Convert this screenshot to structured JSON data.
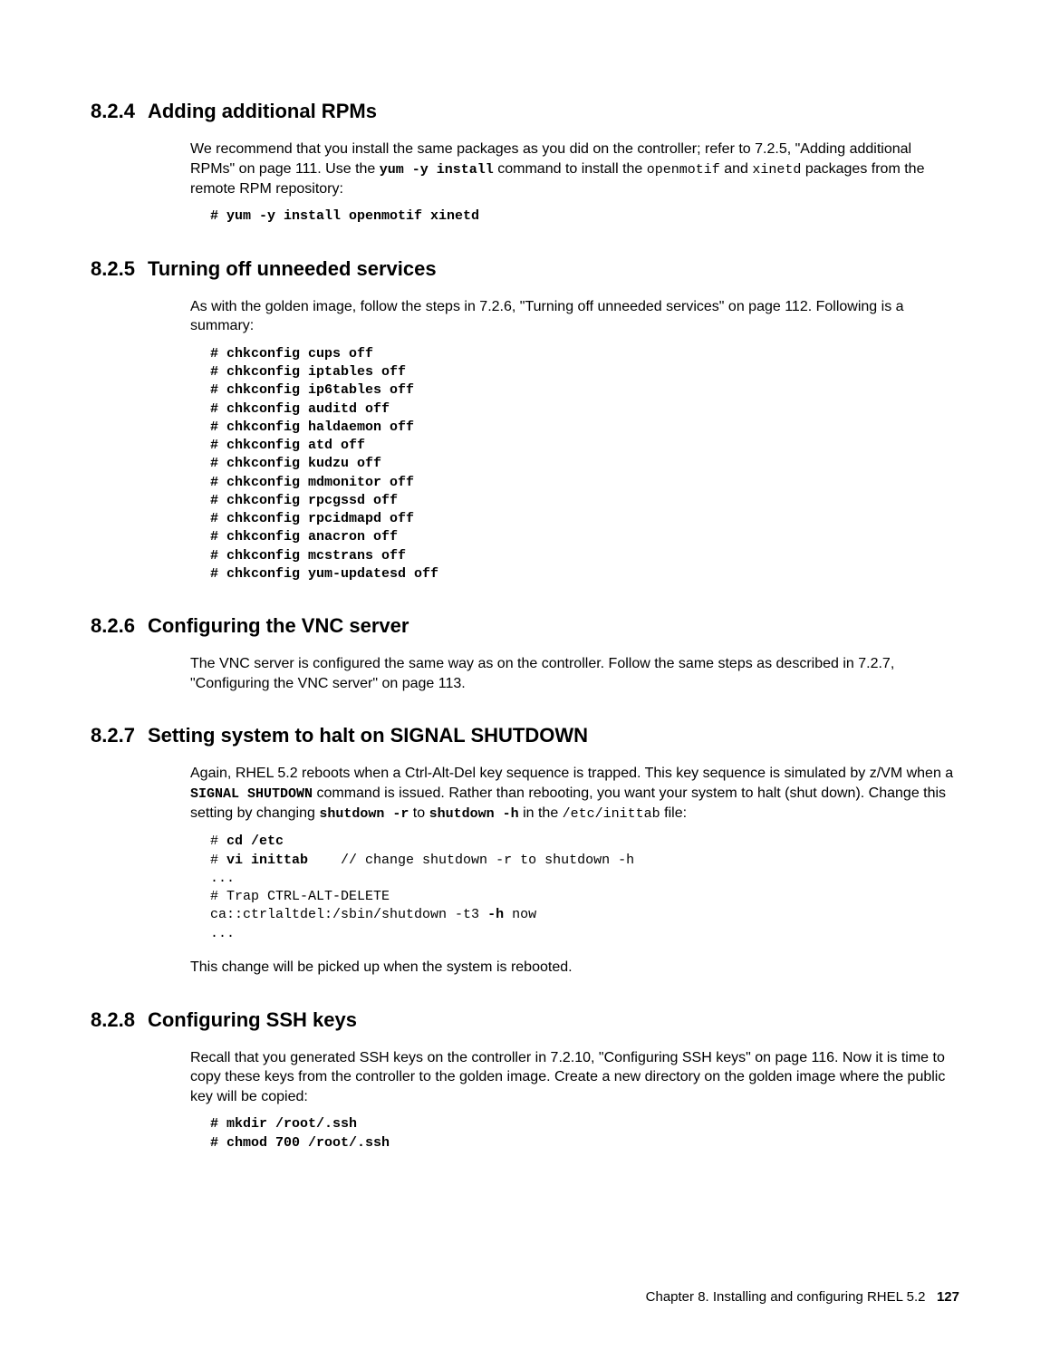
{
  "sections": [
    {
      "num": "8.2.4",
      "title": "Adding additional RPMs",
      "p1": "We recommend that you install the same packages as you did on the controller; refer to 7.2.5, \"Adding additional RPMs\" on page 111. Use the ",
      "c1": "yum -y install",
      "p2": " command to install the ",
      "c2": "openmotif",
      "p3": " and ",
      "c3": "xinetd",
      "p4": " packages from the remote RPM repository:",
      "code": "# yum -y install openmotif xinetd"
    },
    {
      "num": "8.2.5",
      "title": "Turning off unneeded services",
      "p1": "As with the golden image, follow the steps in 7.2.6, \"Turning off unneeded services\" on page 112. Following is a summary:",
      "code": "# chkconfig cups off\n# chkconfig iptables off\n# chkconfig ip6tables off\n# chkconfig auditd off\n# chkconfig haldaemon off\n# chkconfig atd off\n# chkconfig kudzu off\n# chkconfig mdmonitor off\n# chkconfig rpcgssd off\n# chkconfig rpcidmapd off\n# chkconfig anacron off\n# chkconfig mcstrans off\n# chkconfig yum-updatesd off"
    },
    {
      "num": "8.2.6",
      "title": "Configuring the VNC server",
      "p1": "The VNC server is configured the same way as on the controller. Follow the same steps as described in 7.2.7, \"Configuring the VNC server\" on page 113."
    },
    {
      "num": "8.2.7",
      "title": "Setting system to halt on SIGNAL SHUTDOWN",
      "p1": "Again, RHEL 5.2 reboots when a Ctrl-Alt-Del key sequence is trapped. This key sequence is simulated by z/VM when a ",
      "c1": "SIGNAL SHUTDOWN",
      "p2": " command is issued. Rather than rebooting, you want your system to halt (shut down). Change this setting by changing ",
      "c2": "shutdown -r",
      "p3": " to ",
      "c3": "shutdown -h",
      "p4": " in the ",
      "c4": "/etc/inittab",
      "p5": " file:",
      "code_l1": "# ",
      "code_b1": "cd /etc",
      "code_l2": "\n# ",
      "code_b2": "vi inittab",
      "code_l3": "    // change shutdown -r to shutdown -h\n...\n# Trap CTRL-ALT-DELETE\nca::ctrlaltdel:/sbin/shutdown -t3 ",
      "code_b3": "-h",
      "code_l4": " now\n...",
      "p_after": "This change will be picked up when the system is rebooted."
    },
    {
      "num": "8.2.8",
      "title": "Configuring SSH keys",
      "p1": "Recall that you generated SSH keys on the controller in 7.2.10, \"Configuring SSH keys\" on page 116. Now it is time to copy these keys from the controller to the golden image. Create a new directory on the golden image where the public key will be copied:",
      "code": "# mkdir /root/.ssh\n# chmod 700 /root/.ssh"
    }
  ],
  "footer": {
    "chapter": "Chapter 8. Installing and configuring RHEL 5.2",
    "page": "127"
  }
}
